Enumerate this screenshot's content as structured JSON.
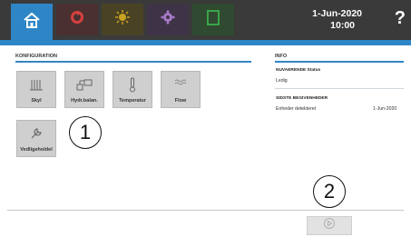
{
  "header": {
    "tabs": [
      {
        "name": "home-icon",
        "color": "#ffffff"
      },
      {
        "name": "recycle-icon",
        "color": "#d64040"
      },
      {
        "name": "sun-icon",
        "color": "#c7a320"
      },
      {
        "name": "gear-icon",
        "color": "#a87ac8"
      },
      {
        "name": "document-icon",
        "color": "#3aa44a"
      }
    ],
    "date": "1-Jun-2020",
    "time": "10:00",
    "help": "?"
  },
  "config": {
    "title": "KONFIGURATION",
    "tiles": [
      {
        "label": "Skyl",
        "icon": "flush-icon"
      },
      {
        "label": "Hydr.balan.",
        "icon": "hydraulic-balance-icon"
      },
      {
        "label": "Temperatur",
        "icon": "thermometer-icon"
      },
      {
        "label": "Flow",
        "icon": "flow-icon"
      },
      {
        "label": "Vedligeholdel",
        "icon": "wrench-icon"
      }
    ]
  },
  "info": {
    "title": "INFO",
    "status_heading": "NUVAERENDE Status",
    "status_value": "Ledig",
    "events_heading": "SIDSTE BEGIVENHEDER",
    "event_text": "Enheder detekteret",
    "event_date": "1-Jun-2020"
  },
  "callouts": {
    "one": "1",
    "two": "2"
  },
  "colors": {
    "accent": "#2f86c6",
    "topbar": "#3a3a3a",
    "tile": "#cfcfcf"
  }
}
